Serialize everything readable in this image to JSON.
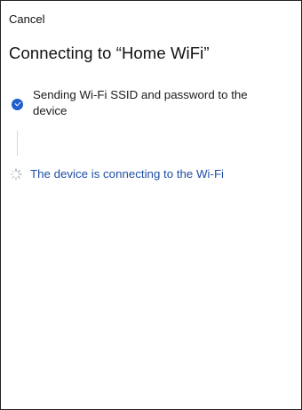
{
  "header": {
    "cancel_label": "Cancel",
    "title": "Connecting to “Home WiFi”"
  },
  "steps": [
    {
      "label": "Sending Wi-Fi SSID and password to the device",
      "status": "done",
      "icon": "check-circle-icon"
    },
    {
      "label": "The device is connecting to the Wi-Fi",
      "status": "in-progress",
      "icon": "spinner-icon"
    }
  ],
  "colors": {
    "accent": "#1f5fcf",
    "active_text": "#1f4fa6",
    "connector": "#d6d6d6"
  }
}
